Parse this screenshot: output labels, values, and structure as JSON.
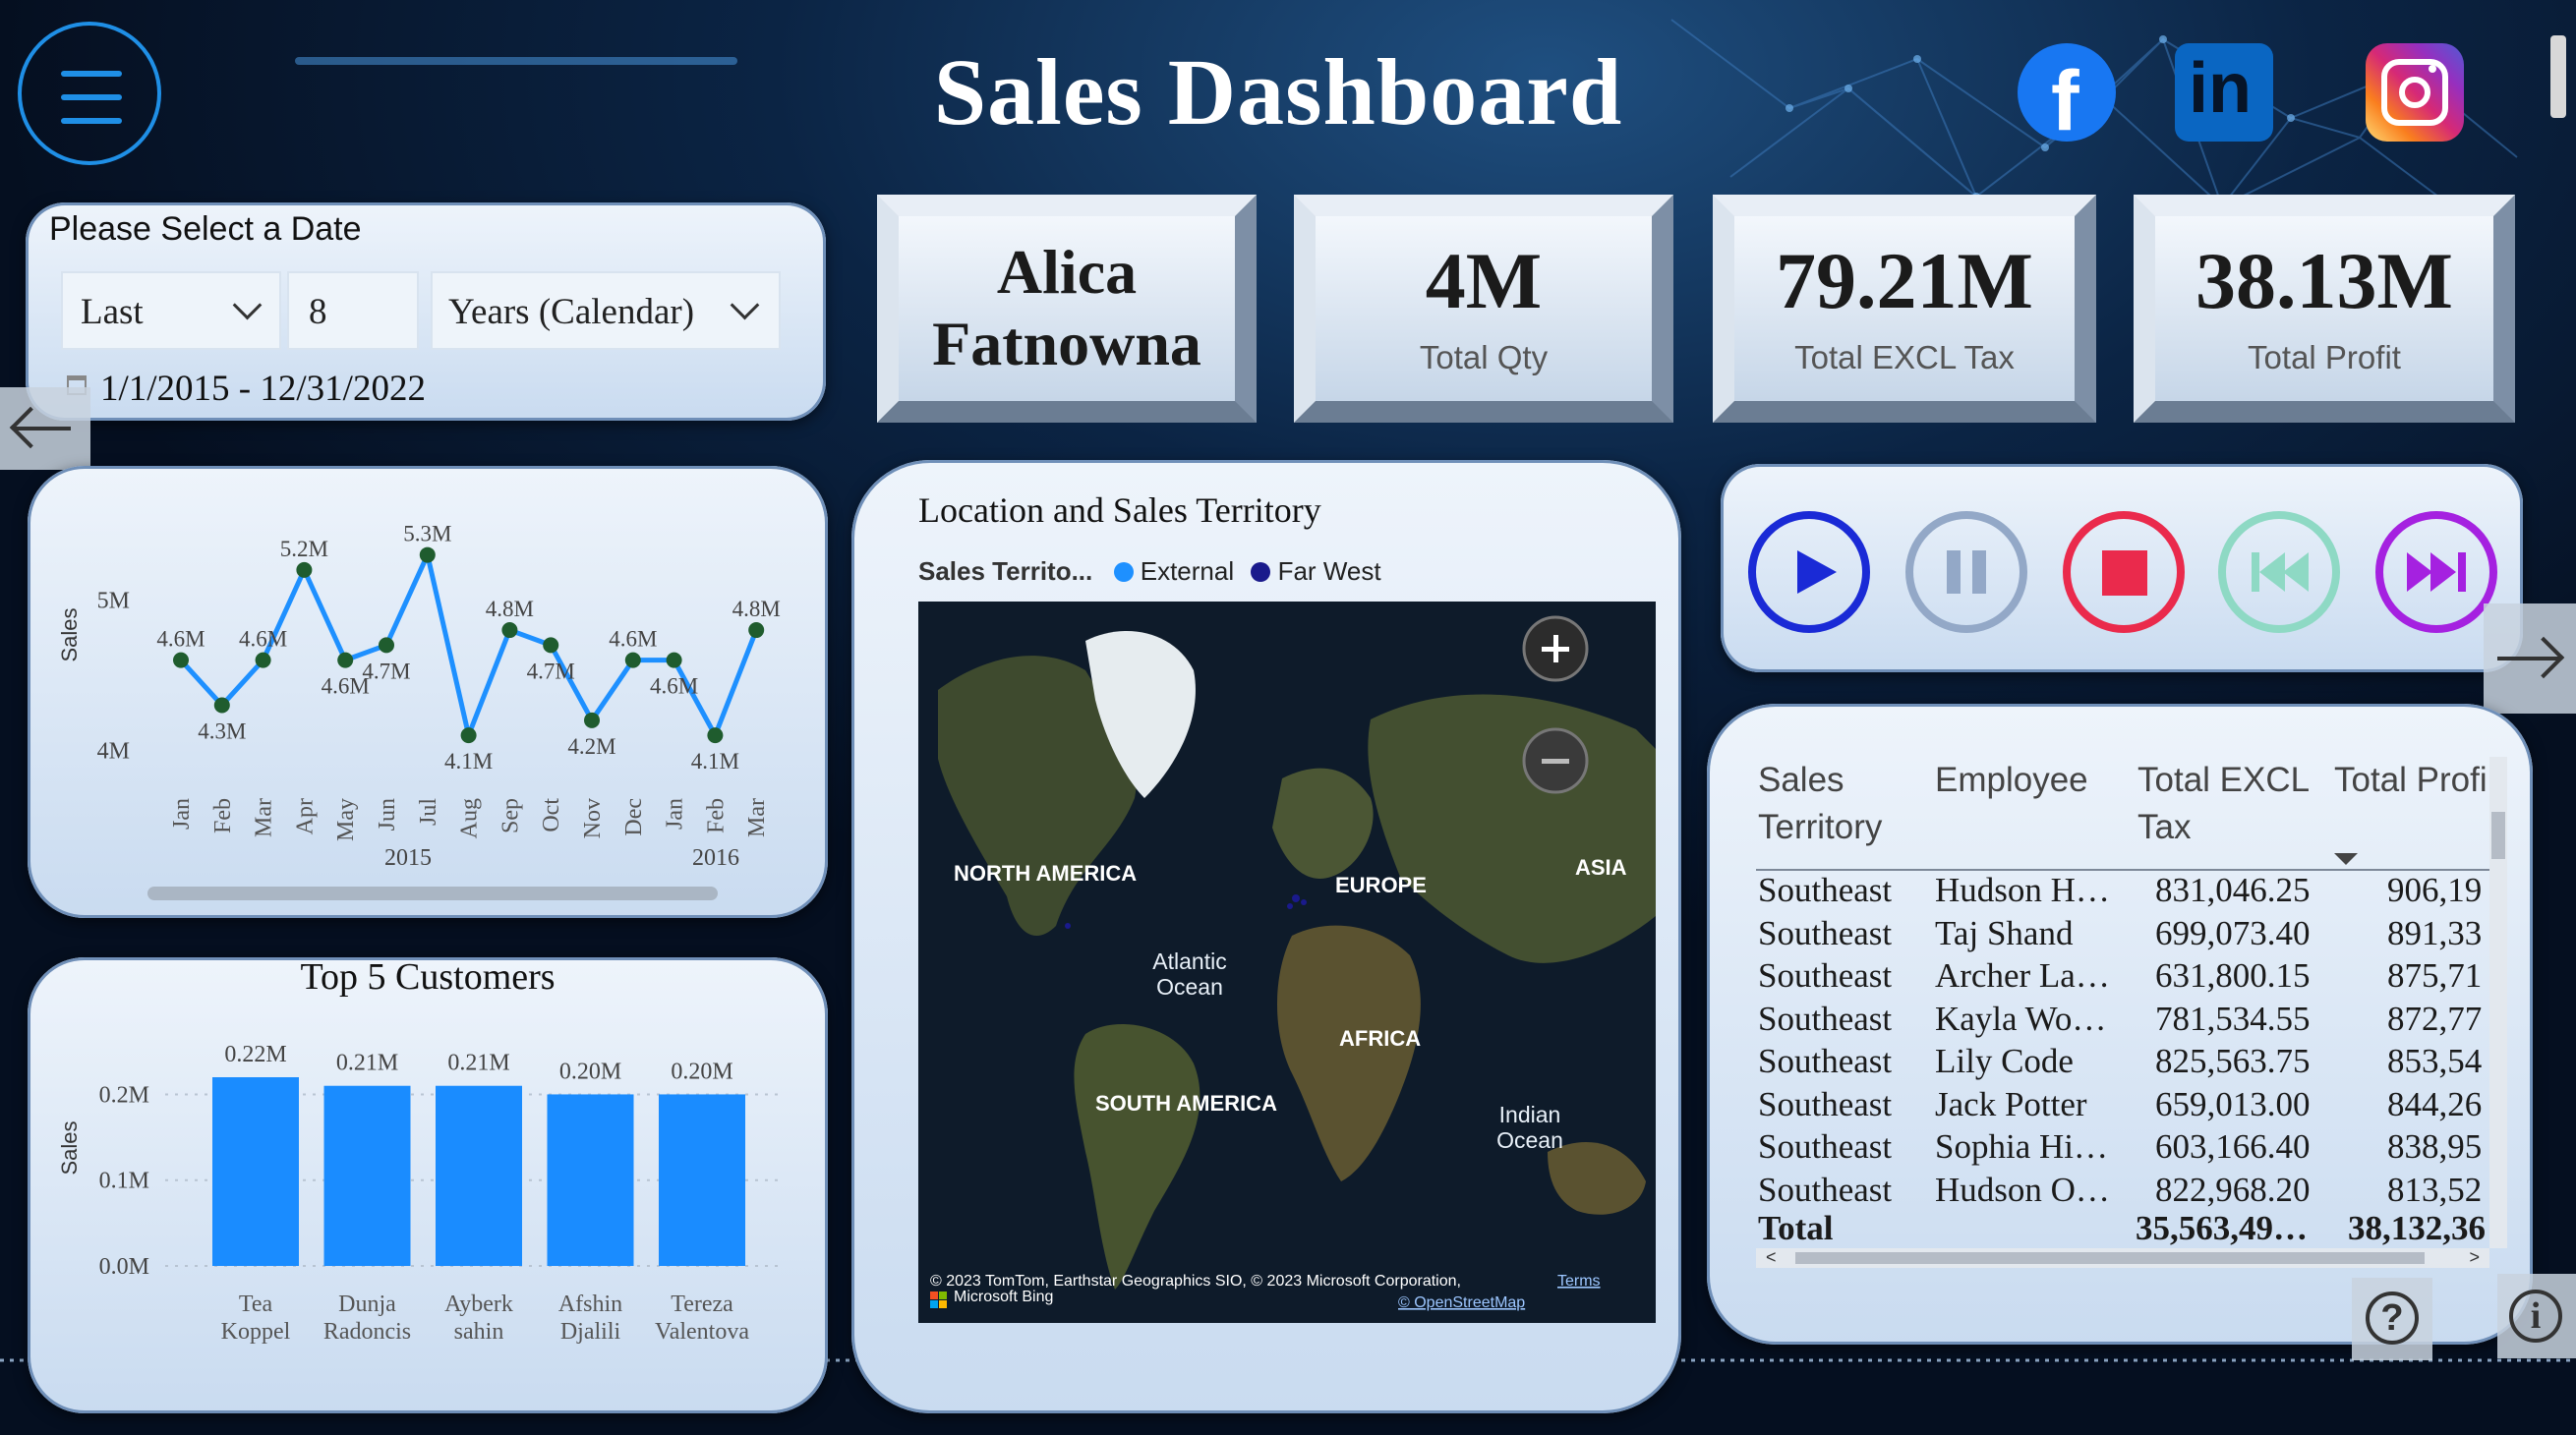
{
  "header": {
    "title": "Sales Dashboard",
    "social": [
      "facebook-icon",
      "linkedin-icon",
      "instagram-icon"
    ]
  },
  "date_filter": {
    "title": "Please Select a Date",
    "period": "Last",
    "count": "8",
    "unit": "Years (Calendar)",
    "range": "1/1/2015 - 12/31/2022"
  },
  "kpis": {
    "employee_name": "Alica Fatnowna",
    "qty_value": "4M",
    "qty_label": "Total Qty",
    "excl_value": "79.21M",
    "excl_label": "Total EXCL Tax",
    "profit_value": "38.13M",
    "profit_label": "Total Profit"
  },
  "line_chart": {
    "ylabel": "Sales",
    "yticks": [
      "5M",
      "4M"
    ],
    "year_labels": [
      "2015",
      "2016"
    ],
    "chart_data": {
      "type": "line",
      "categories": [
        "Jan",
        "Feb",
        "Mar",
        "Apr",
        "May",
        "Jun",
        "Jul",
        "Aug",
        "Sep",
        "Oct",
        "Nov",
        "Dec",
        "Jan",
        "Feb",
        "Mar"
      ],
      "values": [
        4.6,
        4.3,
        4.6,
        5.2,
        4.6,
        4.7,
        5.3,
        4.1,
        4.8,
        4.7,
        4.2,
        4.6,
        4.6,
        4.1,
        4.8
      ],
      "data_labels": [
        "4.6M",
        "4.3M",
        "4.6M",
        "5.2M",
        "4.6M",
        "4.7M",
        "5.3M",
        "4.1M",
        "4.8M",
        "4.7M",
        "4.2M",
        "4.6M",
        "4.6M",
        "4.1M",
        "4.8M"
      ],
      "ylabel": "Sales",
      "ylim": [
        3.8,
        5.5
      ],
      "color": "#1e90ff",
      "marker_color": "#1f5c2e"
    }
  },
  "bar_chart": {
    "title": "Top 5 Customers",
    "ylabel": "Sales",
    "yticks": [
      "0.2M",
      "0.1M",
      "0.0M"
    ],
    "chart_data": {
      "type": "bar",
      "title": "Top 5 Customers",
      "categories": [
        [
          "Tea",
          "Koppel"
        ],
        [
          "Dunja",
          "Radoncis"
        ],
        [
          "Ayberk",
          "sahin"
        ],
        [
          "Afshin",
          "Djalili"
        ],
        [
          "Tereza",
          "Valentova"
        ]
      ],
      "values": [
        0.22,
        0.21,
        0.21,
        0.2,
        0.2
      ],
      "data_labels": [
        "0.22M",
        "0.21M",
        "0.21M",
        "0.20M",
        "0.20M"
      ],
      "ylabel": "Sales",
      "ylim": [
        0,
        0.22
      ],
      "color": "#1a8cff"
    }
  },
  "map": {
    "title": "Location and Sales Territory",
    "legend_title": "Sales Territo...",
    "legend": [
      {
        "name": "External",
        "color": "#1e90ff"
      },
      {
        "name": "Far West",
        "color": "#1a1a8c"
      }
    ],
    "labels": {
      "north_america": "NORTH AMERICA",
      "europe": "EUROPE",
      "asia": "ASIA",
      "africa": "AFRICA",
      "south_america": "SOUTH AMERICA",
      "atlantic": "Atlantic Ocean",
      "indian": "Indian Ocean"
    },
    "attribution": "© 2023 TomTom, Earthstar Geographics SIO, © 2023 Microsoft Corporation,",
    "terms": "Terms",
    "bing": "Microsoft Bing",
    "osm": "© OpenStreetMap"
  },
  "player": {
    "buttons": [
      "play-icon",
      "pause-icon",
      "stop-icon",
      "skip-back-icon",
      "skip-forward-icon"
    ]
  },
  "table": {
    "headers": [
      "Sales Territory",
      "Employee",
      "Total EXCL Tax",
      "Total Profi"
    ],
    "rows": [
      [
        "Southeast",
        "Hudson H…",
        "831,046.25",
        "906,19"
      ],
      [
        "Southeast",
        "Taj Shand",
        "699,073.40",
        "891,33"
      ],
      [
        "Southeast",
        "Archer La…",
        "631,800.15",
        "875,71"
      ],
      [
        "Southeast",
        "Kayla Wo…",
        "781,534.55",
        "872,77"
      ],
      [
        "Southeast",
        "Lily Code",
        "825,563.75",
        "853,54"
      ],
      [
        "Southeast",
        "Jack Potter",
        "659,013.00",
        "844,26"
      ],
      [
        "Southeast",
        "Sophia Hi…",
        "603,166.40",
        "838,95"
      ],
      [
        "Southeast",
        "Hudson O…",
        "822,968.20",
        "813,52"
      ]
    ],
    "total_label": "Total",
    "total_excl": "35,563,49…",
    "total_profit": "38,132,36"
  }
}
